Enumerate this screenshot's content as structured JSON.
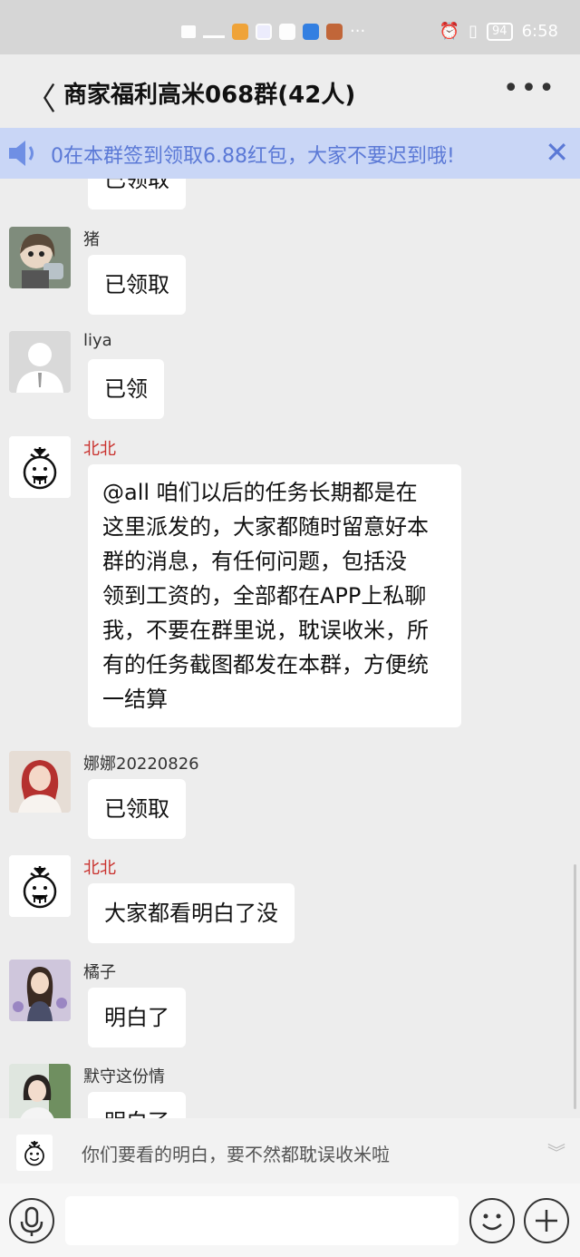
{
  "status_bar": {
    "time": "6:58",
    "battery": "94",
    "more": "···"
  },
  "header": {
    "back": "〈",
    "title": "商家福利高米068群(42人)",
    "more": "•••"
  },
  "notice": {
    "text": "0在本群签到领取6.88红包，大家不要迟到哦!",
    "close": "✕"
  },
  "messages": [
    {
      "sender": "",
      "text": "已领取",
      "avatar": "cropped-avatar"
    },
    {
      "sender": "猪",
      "text": "已领取",
      "avatar": "cartoon-girl-avatar"
    },
    {
      "sender": "liya",
      "text": "已领",
      "avatar": "default-person-avatar"
    },
    {
      "sender": "北北",
      "lines": [
        "@all 咱们以后的任务长期都是在",
        "这里派发的，大家都随时留意好本",
        "群的消息，有任何问题，包括没",
        "领到工资的，全部都在APP上私聊",
        "我，不要在群里说，耽误收米，所",
        "有的任务截图都发在本群，方便统",
        "一结算"
      ],
      "avatar": "doodle-face-avatar"
    },
    {
      "sender": "娜娜20220826",
      "text": "已领取",
      "avatar": "woman-photo-avatar"
    },
    {
      "sender": "北北",
      "text": "大家都看明白了没",
      "avatar": "doodle-face-avatar"
    },
    {
      "sender": "橘子",
      "text": "明白了",
      "avatar": "illustrated-girl-avatar"
    },
    {
      "sender": "默守这份情",
      "text": "明白了",
      "avatar": "woman-photo-avatar"
    }
  ],
  "preview": {
    "text": "你们要看的明白，要不然都耽误收米啦",
    "chevron": "︾"
  },
  "input": {
    "placeholder": ""
  },
  "colors": {
    "accent_blue": "#5b79d6",
    "notice_bg": "#c9d6f6",
    "sender_red": "#c9302c",
    "chat_bg": "#ededed"
  }
}
